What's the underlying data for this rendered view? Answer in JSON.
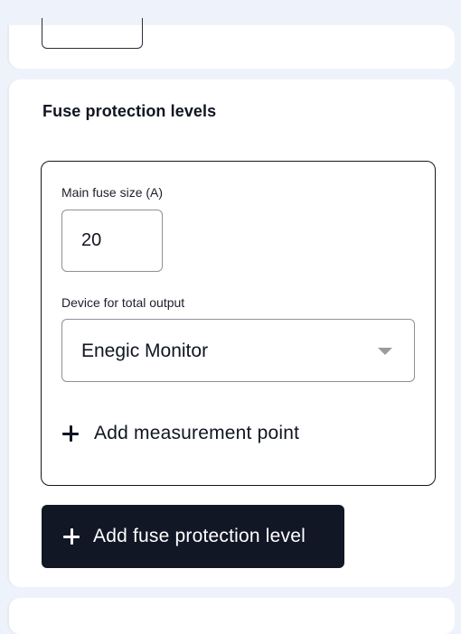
{
  "section": {
    "title": "Fuse protection levels"
  },
  "level": {
    "main_fuse_label": "Main fuse size (A)",
    "main_fuse_value": "20",
    "device_label": "Device for total output",
    "device_selected": "Enegic Monitor",
    "add_measurement_point_label": "Add measurement point"
  },
  "actions": {
    "add_fuse_level_label": "Add fuse protection level"
  },
  "icons": {
    "add_point": "plus-icon",
    "add_level": "plus-icon",
    "dropdown": "chevron-down-icon"
  },
  "colors": {
    "background": "#eef3fb",
    "card": "#ffffff",
    "primary_button": "#121726",
    "text": "#101521"
  }
}
